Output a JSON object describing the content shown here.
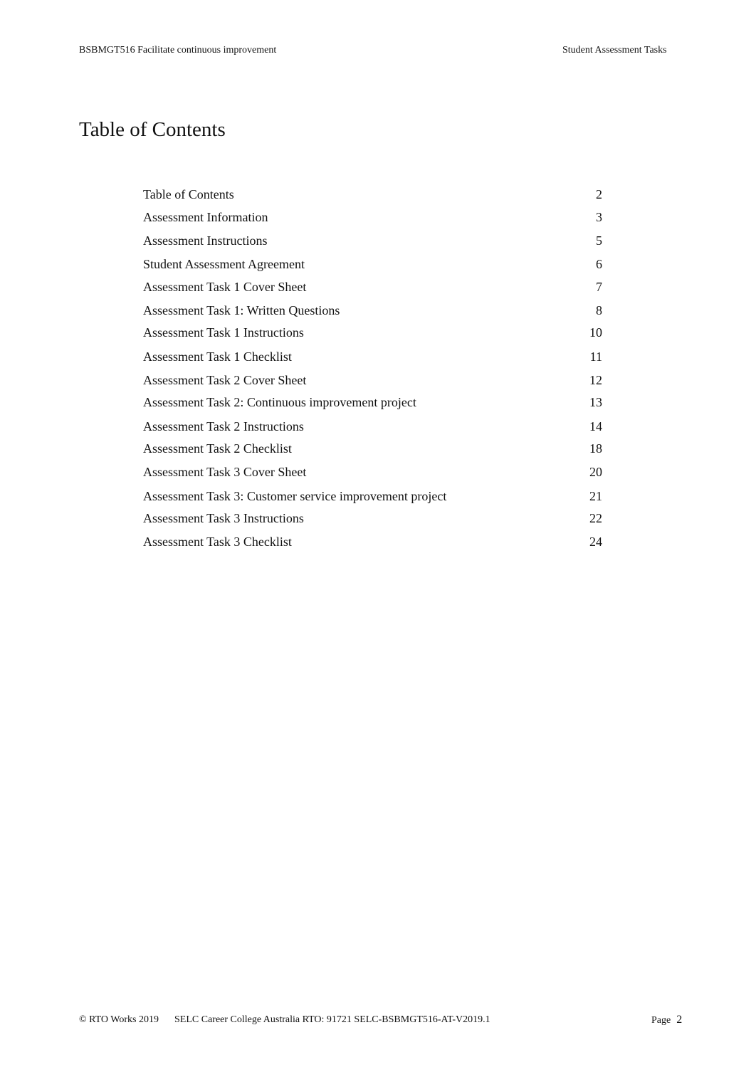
{
  "header": {
    "left": "BSBMGT516 Facilitate continuous improvement",
    "right": "Student Assessment Tasks"
  },
  "title": "Table of Contents",
  "toc": [
    {
      "label": "Table of Contents",
      "page": "2"
    },
    {
      "label": "Assessment Information",
      "page": "3"
    },
    {
      "label": "Assessment Instructions",
      "page": "5"
    },
    {
      "label": "Student Assessment Agreement",
      "page": "6"
    },
    {
      "label": "Assessment Task 1 Cover Sheet",
      "page": "7"
    },
    {
      "label": "Assessment Task 1: Written Questions",
      "page": "8"
    },
    {
      "label": "Assessment Task 1 Instructions",
      "page": "10"
    },
    {
      "label": "Assessment Task 1 Checklist",
      "page": "11"
    },
    {
      "label": "Assessment Task 2 Cover Sheet",
      "page": "12"
    },
    {
      "label": "Assessment Task 2: Continuous improvement project",
      "page": "13"
    },
    {
      "label": "Assessment Task 2 Instructions",
      "page": "14"
    },
    {
      "label": "Assessment Task 2 Checklist",
      "page": "18"
    },
    {
      "label": "Assessment Task 3 Cover Sheet",
      "page": "20"
    },
    {
      "label": "Assessment Task 3: Customer service improvement project",
      "page": "21"
    },
    {
      "label": "Assessment Task 3 Instructions",
      "page": "22"
    },
    {
      "label": "Assessment Task 3 Checklist",
      "page": "24"
    }
  ],
  "footer": {
    "copyright": "© RTO Works 2019",
    "rto": "SELC Career College Australia RTO: 91721 SELC-BSBMGT516-AT-V2019.1",
    "page_label": "Page",
    "page_number": "2"
  }
}
